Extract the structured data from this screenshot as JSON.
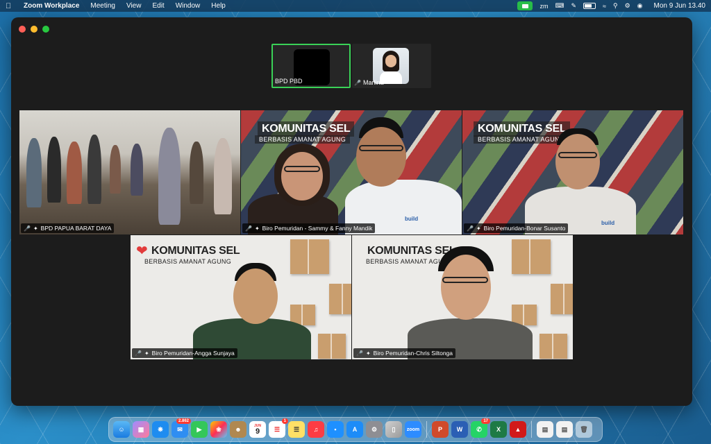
{
  "menubar": {
    "app_name": "Zoom Workplace",
    "menus": [
      "Meeting",
      "View",
      "Edit",
      "Window",
      "Help"
    ],
    "clock": "Mon 9 Jun  13.40"
  },
  "strip": {
    "tiles": [
      {
        "name": "BPD PBD",
        "active": true
      },
      {
        "name": "Marlina",
        "active": false
      }
    ]
  },
  "grid": {
    "tiles": [
      {
        "name": "BPD PAPUA BARAT DAYA"
      },
      {
        "name": "Biro Pemuridan - Sammy & Fanny Mandik",
        "banner": "KOMUNITAS SEL",
        "banner_sub": "BERBASIS AMANAT AGUNG"
      },
      {
        "name": "Biro Pemuridan-Bonar Susanto",
        "banner": "KOMUNITAS SEL",
        "banner_sub": "BERBASIS AMANAT AGUNG"
      },
      {
        "name": "Biro Pemuridan-Angga Sunjaya",
        "banner": "KOMUNITAS SEL",
        "banner_sub": "BERBASIS AMANAT AGUNG"
      },
      {
        "name": "Biro Pemuridan-Chris Siltonga",
        "banner": "KOMUNITAS SEL",
        "banner_sub": "BERBASIS AMANAT AGUNG"
      }
    ],
    "logo_text": "build"
  },
  "dock": {
    "mail_badge": "2.862",
    "calendar_month": "JUN",
    "calendar_day": "9",
    "reminders_badge": "1",
    "whatsapp_badge": "17",
    "zoom_label": "zoom"
  },
  "colors": {
    "accent_green": "#3ad257",
    "mic_off": "#ff4a4a"
  }
}
